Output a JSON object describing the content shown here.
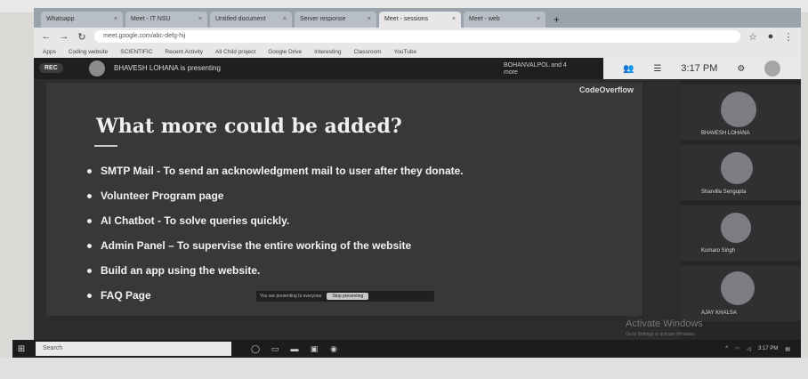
{
  "browser": {
    "tabs": [
      {
        "label": "Whatsapp"
      },
      {
        "label": "Meet - IT NSU"
      },
      {
        "label": "Untitled document"
      },
      {
        "label": "Server response"
      },
      {
        "label": "Meet - sessions"
      },
      {
        "label": "Meet - web"
      }
    ],
    "new_tab": "+",
    "url": "meet.google.com/abc-defg-hij",
    "bookmarks": [
      "Apps",
      "Coding website",
      "SCIENTIFIC",
      "Recent Activity",
      "All Child project",
      "Google Drive",
      "Interesting",
      "Classroom",
      "YouTube"
    ]
  },
  "meet": {
    "rec": "REC",
    "presenting_text": "BHAVESH LOHANA is presenting",
    "pinned_text": "BOHANVALPOL and 4 more",
    "clock": "3:17 PM",
    "slide": {
      "brand": "CodeOverflow",
      "title": "What more could be added?",
      "bullets": [
        "SMTP Mail - To send an acknowledgment mail to user after they donate.",
        "Volunteer Program page",
        "AI Chatbot - To solve queries quickly.",
        "Admin Panel – To supervise the entire working of the website",
        "Build an app using the website.",
        "FAQ Page"
      ],
      "stop_message": "You are presenting to everyone",
      "stop_button": "Stop presenting"
    },
    "participants": [
      {
        "name": "BHAVESH LOHANA"
      },
      {
        "name": "Sharvilla Sengupta"
      },
      {
        "name": "Kumaro Singh"
      },
      {
        "name": "AJAY KHALSA"
      }
    ],
    "watermark_title": "Activate Windows",
    "watermark_sub": "Go to Settings to activate Windows."
  },
  "taskbar": {
    "search_placeholder": "Search",
    "time": "3:17 PM"
  }
}
